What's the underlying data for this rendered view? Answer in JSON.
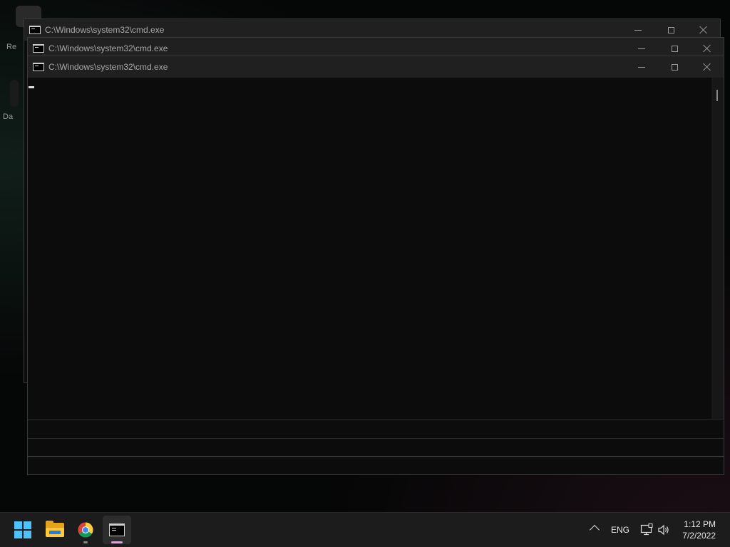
{
  "desktop": {
    "labels": [
      "Re",
      "Da"
    ]
  },
  "windows": [
    {
      "title": "C:\\Windows\\system32\\cmd.exe",
      "icon": "cmd-icon",
      "buttons": {
        "minimize": "minimize-icon",
        "maximize": "maximize-icon",
        "close": "close-icon"
      }
    },
    {
      "title": "C:\\Windows\\system32\\cmd.exe",
      "icon": "cmd-icon",
      "buttons": {
        "minimize": "minimize-icon",
        "maximize": "maximize-icon",
        "close": "close-icon"
      }
    },
    {
      "title": "C:\\Windows\\system32\\cmd.exe",
      "icon": "cmd-icon",
      "buttons": {
        "minimize": "minimize-icon",
        "maximize": "maximize-icon",
        "close": "close-icon"
      }
    }
  ],
  "taskbar": {
    "apps": [
      {
        "name": "start",
        "icon": "windows-logo-icon"
      },
      {
        "name": "file-explorer",
        "icon": "folder-icon"
      },
      {
        "name": "chrome",
        "icon": "chrome-icon"
      },
      {
        "name": "command-prompt",
        "icon": "cmd-icon"
      }
    ],
    "tray": {
      "language": "ENG",
      "time": "1:12 PM",
      "date": "7/2/2022"
    }
  },
  "colors": {
    "console_bg": "#0c0c0c",
    "titlebar_bg": "#202020",
    "taskbar_bg": "#1c1c1c",
    "start_accent": "#4cc2ff",
    "active_indicator": "#d6a3d4"
  }
}
